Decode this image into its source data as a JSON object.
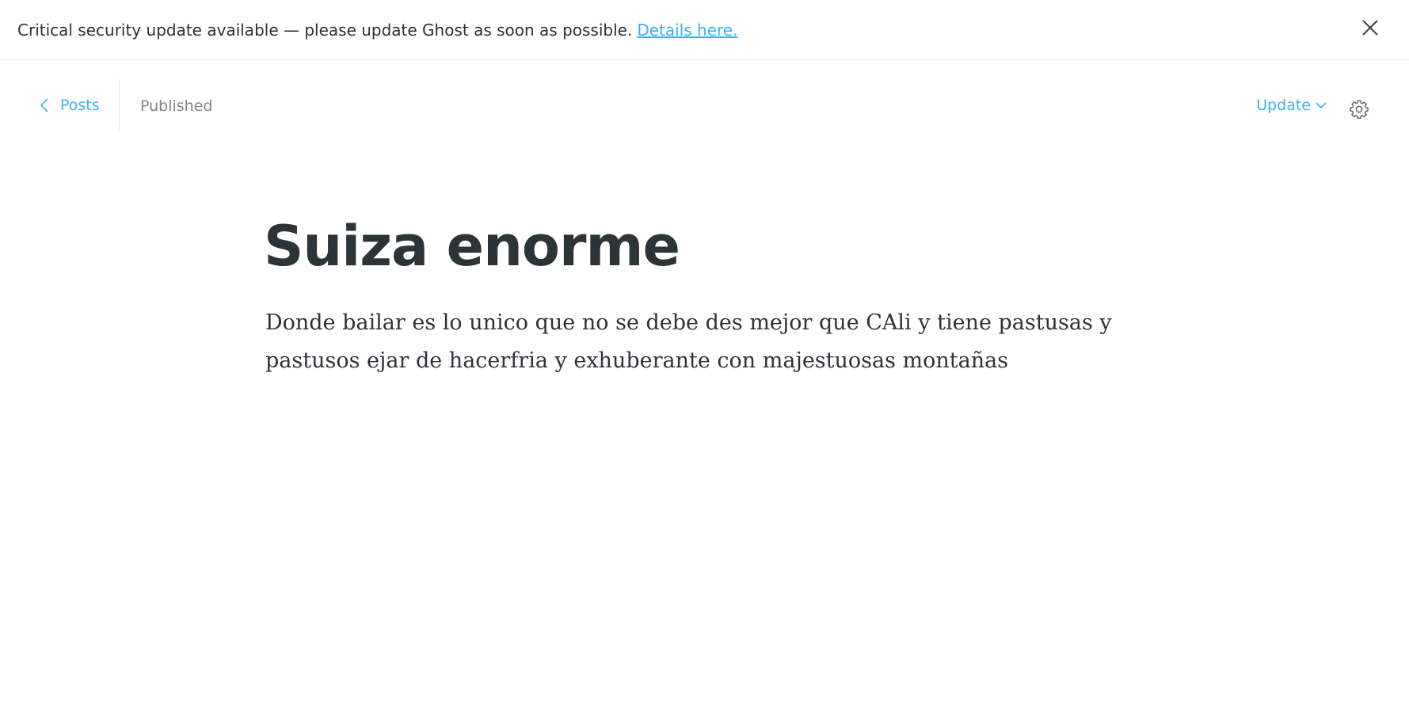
{
  "banner": {
    "message": "Critical security update available — please update Ghost as soon as possible.",
    "link_text": "Details here.",
    "close_icon": "close-icon"
  },
  "header": {
    "back_label": "Posts",
    "back_icon": "chevron-left-icon",
    "status": "Published",
    "update_label": "Update",
    "update_icon": "chevron-down-icon",
    "settings_icon": "gear-icon"
  },
  "post": {
    "title": "Suiza enorme",
    "body": "Donde bailar es lo unico que no se debe des mejor que CAli y tiene pastusas y pastusos ejar de hacerfria y exhuberante con majestuosas montañas"
  },
  "colors": {
    "accent": "#3eb0ef",
    "text": "#2c3438",
    "muted": "#7d878a",
    "border": "#e5e8ea"
  }
}
